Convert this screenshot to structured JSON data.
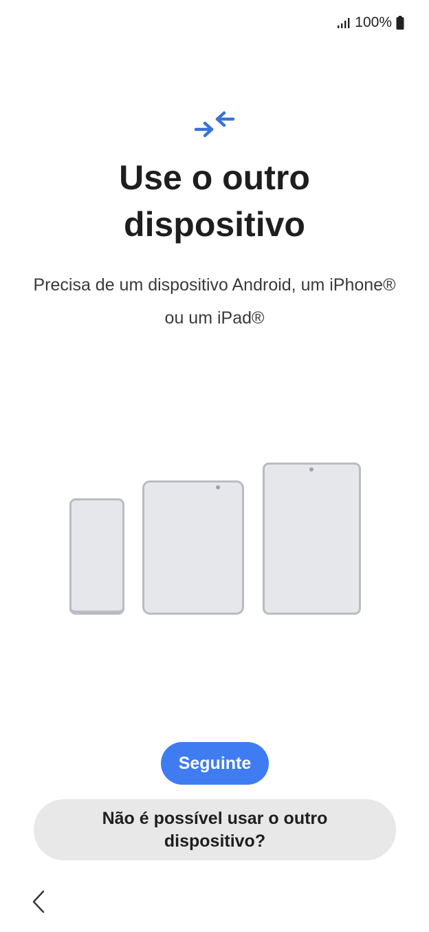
{
  "status_bar": {
    "battery_text": "100%",
    "signal_icon": "signal-bars-icon",
    "battery_icon": "battery-icon"
  },
  "header": {
    "icon": "transfer-arrows-icon",
    "title": "Use o outro\ndispositivo",
    "subtitle": "Precisa de um dispositivo Android, um iPhone® ou um iPad®"
  },
  "illustration": {
    "devices": [
      "phone",
      "foldable",
      "tablet"
    ]
  },
  "actions": {
    "next_label": "Seguinte",
    "alt_label": "Não é possível usar o outro dispositivo?"
  },
  "navigation": {
    "back_icon": "chevron-left-icon"
  },
  "colors": {
    "accent": "#3f7cf2",
    "icon_blue": "#3a72d8",
    "secondary_button": "#e8e8e9",
    "device_fill": "#e6e7ea",
    "device_border": "#b9bcc2"
  }
}
